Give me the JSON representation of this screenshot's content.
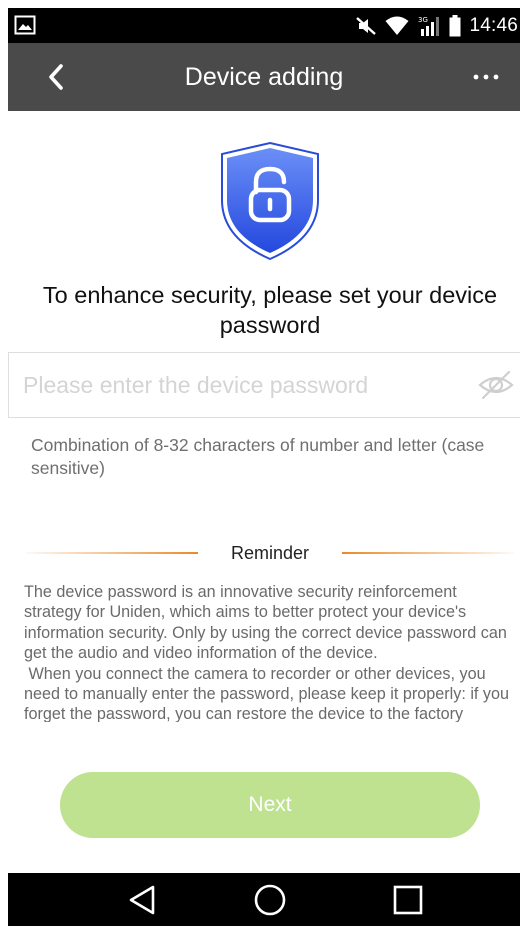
{
  "status_bar": {
    "time": "14:46",
    "icons": [
      "gallery-icon",
      "mute-icon",
      "wifi-icon",
      "signal-3g-icon",
      "battery-icon"
    ]
  },
  "app_bar": {
    "title": "Device adding",
    "back_icon": "chevron-left-icon",
    "more_icon": "more-horizontal-icon"
  },
  "shield": {
    "icon": "shield-lock-icon",
    "colors": {
      "top": "#5d84f5",
      "bottom": "#2a4fe0",
      "border": "#274bd9"
    }
  },
  "heading": "To enhance security, please set your device password",
  "password_field": {
    "placeholder": "Please enter the device password",
    "value": "",
    "toggle_icon": "eye-off-icon"
  },
  "hint": "Combination of 8-32 characters of number and letter (case sensitive)",
  "reminder": {
    "label": "Reminder",
    "paragraphs": [
      "The device password is an innovative security reinforcement strategy for Uniden, which aims to better protect your device's information security. Only by using the correct device password can get the audio and video information of the device.",
      " When you connect the camera to recorder or other devices, you need to manually enter the password, please keep it properly: if you forget the password, you can restore the device to the factory settings."
    ],
    "accent_color": "#ea8a2a"
  },
  "next_button": {
    "label": "Next",
    "color": "#bee28f"
  },
  "nav_bar": {
    "items": [
      "back-triangle-icon",
      "home-circle-icon",
      "recents-square-icon"
    ]
  }
}
